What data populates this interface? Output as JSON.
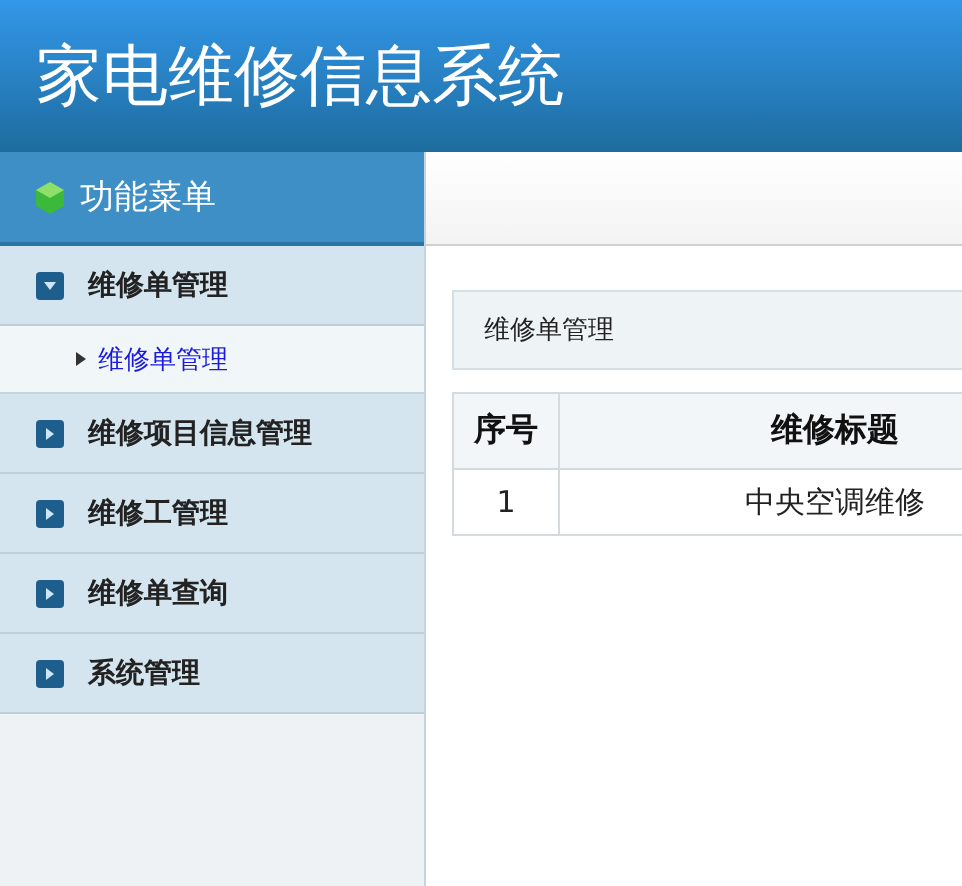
{
  "header": {
    "title": "家电维修信息系统"
  },
  "sidebar": {
    "title": "功能菜单",
    "items": [
      {
        "label": "维修单管理",
        "expanded": true,
        "children": [
          {
            "label": "维修单管理",
            "selected": true
          }
        ]
      },
      {
        "label": "维修项目信息管理",
        "expanded": false
      },
      {
        "label": "维修工管理",
        "expanded": false
      },
      {
        "label": "维修单查询",
        "expanded": false
      },
      {
        "label": "系统管理",
        "expanded": false
      }
    ]
  },
  "panel": {
    "title": "维修单管理"
  },
  "table": {
    "columns": [
      "序号",
      "维修标题"
    ],
    "rows": [
      [
        "1",
        "中央空调维修"
      ]
    ]
  }
}
